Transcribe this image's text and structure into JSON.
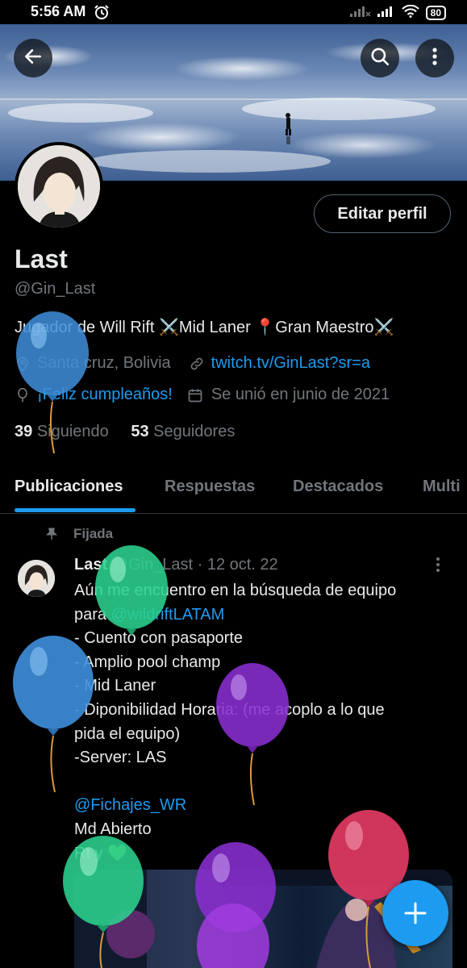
{
  "status_bar": {
    "time": "5:56 AM",
    "battery": "80"
  },
  "banner": {
    "back_icon": "arrow-left-icon",
    "search_icon": "search-icon",
    "more_icon": "more-vertical-icon"
  },
  "profile": {
    "edit_button": "Editar perfil",
    "name": "Last",
    "handle": "@Gin_Last",
    "bio": "Jugador de Will Rift ⚔️Mid Laner 📍Gran Maestro⚔️",
    "location": "Santa cruz, Bolivia",
    "website": "twitch.tv/GinLast?sr=a",
    "birthday": "¡Feliz cumpleaños!",
    "joined": "Se unió en junio de 2021",
    "following_count": "39",
    "following_label": "Siguiendo",
    "followers_count": "53",
    "followers_label": "Seguidores"
  },
  "tabs": [
    "Publicaciones",
    "Respuestas",
    "Destacados",
    "Multi"
  ],
  "post": {
    "pinned_label": "Fijada",
    "author": "Last",
    "author_handle": "@Gin_Last",
    "date": "· 12 oct. 22",
    "lines": [
      "Aún me encuentro en la búsqueda de equipo",
      "para ",
      "- Cuento con pasaporte",
      "- Amplio pool champ",
      "- Mid Laner",
      "- Diponibilidad Horaria: (me acoplo a lo que",
      "pida el equipo)",
      "-Server: LAS",
      "",
      "",
      "Md Abierto",
      "Rt y 💚"
    ],
    "mention_1": "@wildriftLATAM",
    "mention_2": "@Fichajes_WR"
  },
  "fab": {
    "icon": "plus-icon",
    "label": "+"
  },
  "colors": {
    "accent": "#1d9bf0",
    "muted": "#71767b",
    "text": "#e7e9ea",
    "background": "#000000"
  }
}
